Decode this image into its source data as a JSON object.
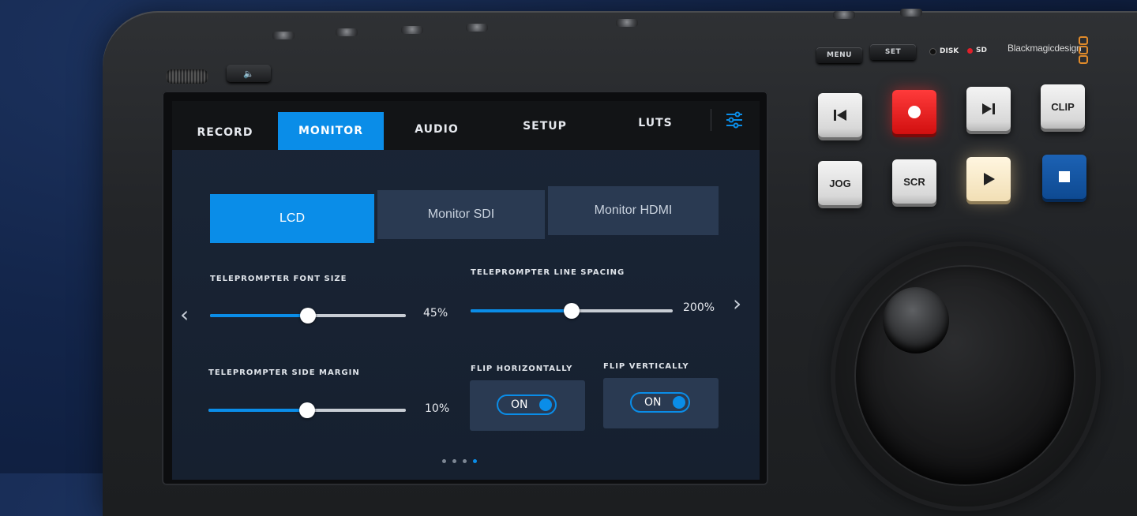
{
  "device": {
    "top_buttons": {
      "menu": "MENU",
      "set": "SET"
    },
    "indicators": [
      {
        "label": "DISK",
        "color": "#111111"
      },
      {
        "label": "SD",
        "color": "#e0202a"
      }
    ],
    "brand": "Blackmagicdesign",
    "keys": [
      {
        "name": "previous-key",
        "label": "",
        "icon": "skip-previous-icon"
      },
      {
        "name": "record-key",
        "label": "",
        "icon": "record-icon"
      },
      {
        "name": "next-key",
        "label": "",
        "icon": "skip-next-icon"
      },
      {
        "name": "clip-key",
        "label": "CLIP"
      },
      {
        "name": "jog-key",
        "label": "JOG"
      },
      {
        "name": "scr-key",
        "label": "SCR"
      },
      {
        "name": "play-key",
        "label": "",
        "icon": "play-icon"
      },
      {
        "name": "stop-key",
        "label": "",
        "icon": "stop-icon"
      }
    ]
  },
  "screen": {
    "tabs": [
      "RECORD",
      "MONITOR",
      "AUDIO",
      "SETUP",
      "LUTS"
    ],
    "active_tab": "MONITOR",
    "segments": [
      "LCD",
      "Monitor SDI",
      "Monitor HDMI"
    ],
    "active_segment": "LCD",
    "sliders": [
      {
        "label": "TELEPROMPTER FONT SIZE",
        "value": "45%",
        "level": 0.5
      },
      {
        "label": "TELEPROMPTER LINE SPACING",
        "value": "200%",
        "level": 0.5
      },
      {
        "label": "TELEPROMPTER SIDE MARGIN",
        "value": "10%",
        "level": 0.5
      }
    ],
    "toggles": [
      {
        "label": "FLIP HORIZONTALLY",
        "state": "ON"
      },
      {
        "label": "FLIP VERTICALLY",
        "state": "ON"
      }
    ],
    "pagination": {
      "pages": 4,
      "current": 4
    },
    "accent_color": "#0a8de8"
  }
}
